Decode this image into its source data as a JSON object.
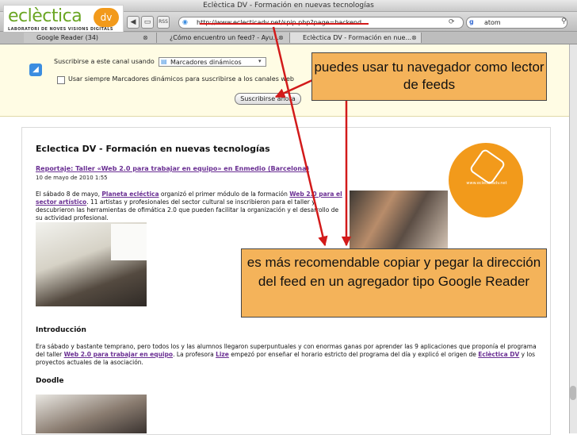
{
  "window": {
    "title": "Eclèctica DV - Formación en nuevas tecnologías"
  },
  "logo": {
    "name": "eclèctica",
    "suffix": "dv",
    "tagline": "LABORATORI DE NOVES VISIONS DIGITALS"
  },
  "toolbar": {
    "url": "http://www.eclecticadv.net/spip.php?page=backend",
    "search_value": "atom"
  },
  "tabs": [
    {
      "label": "Google Reader (34)"
    },
    {
      "label": "¿Cómo encuentro un feed? - Ayu..."
    },
    {
      "label": "Eclèctica DV - Formación en nue..."
    }
  ],
  "feed_panel": {
    "subscribe_label": "Suscribirse a este canal usando",
    "reader_option": "Marcadores dinámicos",
    "always_label": "Usar siempre Marcadores dinámicos para suscribirse a los canales web",
    "subscribe_button": "Suscribirse ahora"
  },
  "page": {
    "site_title": "Eclectica DV - Formación en nuevas tecnologías",
    "post_title": "Reportaje: Taller «Web 2.0 para trabajar en equipo» en Enmedio (Barcelona)",
    "post_date": "10 de mayo de 2010 1:55",
    "para1_a": "El sábado 8 de mayo, ",
    "para1_link1": "Planeta ecléctica",
    "para1_b": " organizó el primer módulo de la formación ",
    "para1_link2": "Web 2.0 para el sector artístico",
    "para1_c": ". 11 artistas y profesionales del sector cultural se inscribieron para el taller y descubrieron las herramientas de ofimática 2.0 que pueden facilitar la organización y el desarrollo de su actividad profesional.",
    "circle_text": "www.eclecticadv.net",
    "section_intro": "Introducción",
    "para2_a": "Era sábado y bastante temprano, pero todos los y las alumnos llegaron superpuntuales y con enormas ganas por aprender las 9 aplicaciones que proponía el programa del taller ",
    "para2_link1": "Web 2.0 para trabajar en equipo",
    "para2_b": ". La profesora ",
    "para2_link2": "Lize",
    "para2_c": " empezó por enseñar el horario estricto del programa del día y explicó el origen de ",
    "para2_link3": "Eclèctica DV",
    "para2_d": " y los proyectos actuales de la asociación.",
    "section_doodle": "Doodle"
  },
  "annotations": {
    "top": "puedes usar tu navegador como lector de feeds",
    "bottom": "es más recomendable copiar y pegar la dirección del feed en un agregador tipo Google Reader"
  },
  "colors": {
    "callout": "#f4b35a",
    "arrow": "#d21a1a",
    "brand_green": "#6aa523",
    "brand_orange": "#f29a1b",
    "link": "#6a2f93"
  }
}
